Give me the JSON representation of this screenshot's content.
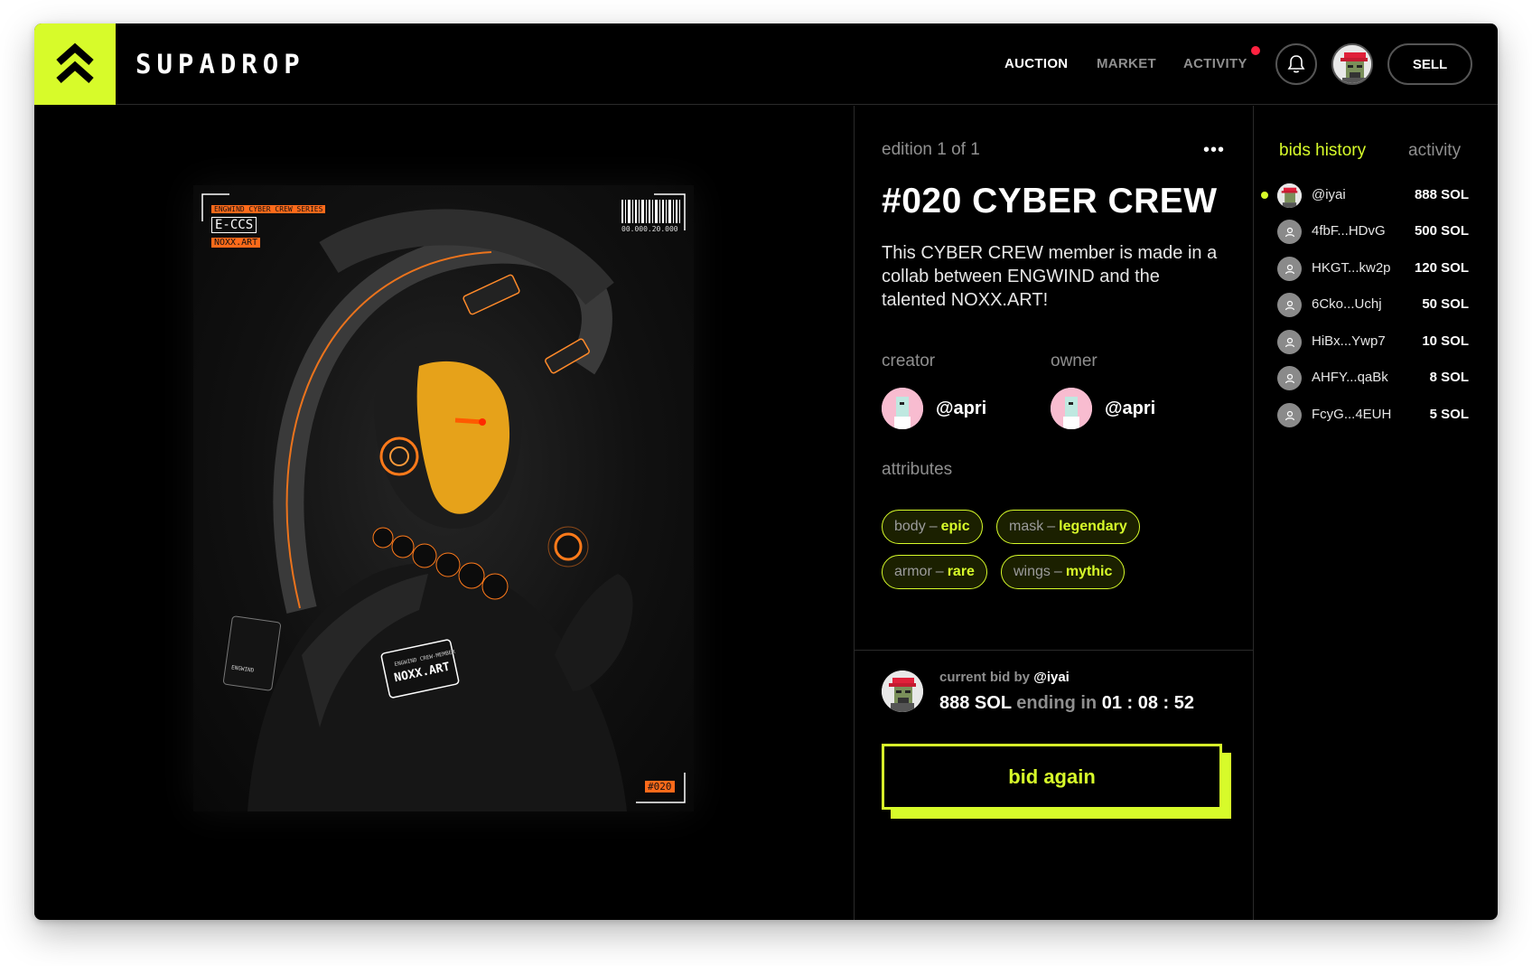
{
  "brand": {
    "name": "SUPADROP",
    "accent": "#d7fb2a"
  },
  "nav": {
    "items": [
      {
        "label": "AUCTION",
        "active": true
      },
      {
        "label": "MARKET",
        "active": false
      },
      {
        "label": "ACTIVITY",
        "active": false
      }
    ],
    "sell_label": "SELL",
    "notification_icon": "bell-icon",
    "has_notification": true
  },
  "artwork": {
    "series_label": "ENGWIND CYBER CREW SERIES",
    "code": "E-CCS",
    "artist_tag": "NOXX.ART",
    "barcode_text": "00.000.20.000",
    "badge_name": "NOXX.ART",
    "badge_sub": "ENGWIND CREW-MEMBER",
    "patch_text": "ENGWIND",
    "number_tag": "#020"
  },
  "item": {
    "edition": "edition 1 of 1",
    "title": "#020 CYBER CREW",
    "description": "This CYBER CREW member is made in a collab between ENGWIND and the talented NOXX.ART!",
    "creator_label": "creator",
    "creator_name": "@apri",
    "owner_label": "owner",
    "owner_name": "@apri",
    "attributes_label": "attributes",
    "attributes": [
      {
        "key": "body",
        "value": "epic"
      },
      {
        "key": "mask",
        "value": "legendary"
      },
      {
        "key": "armor",
        "value": "rare"
      },
      {
        "key": "wings",
        "value": "mythic"
      }
    ],
    "attribute_separator": "–"
  },
  "current_bid": {
    "prefix": "current bid by",
    "bidder": "@iyai",
    "amount": "888 SOL",
    "ending_text": "ending in",
    "countdown": "01 : 08 : 52",
    "button_label": "bid again"
  },
  "bids_panel": {
    "tabs": [
      {
        "label": "bids history",
        "active": true
      },
      {
        "label": "activity",
        "active": false
      }
    ],
    "bids": [
      {
        "bidder": "@iyai",
        "amount": "888 SOL",
        "latest": true
      },
      {
        "bidder": "4fbF...HDvG",
        "amount": "500 SOL",
        "latest": false
      },
      {
        "bidder": "HKGT...kw2p",
        "amount": "120 SOL",
        "latest": false
      },
      {
        "bidder": "6Cko...Uchj",
        "amount": "50 SOL",
        "latest": false
      },
      {
        "bidder": "HiBx...Ywp7",
        "amount": "10 SOL",
        "latest": false
      },
      {
        "bidder": "AHFY...qaBk",
        "amount": "8 SOL",
        "latest": false
      },
      {
        "bidder": "FcyG...4EUH",
        "amount": "5 SOL",
        "latest": false
      }
    ]
  }
}
